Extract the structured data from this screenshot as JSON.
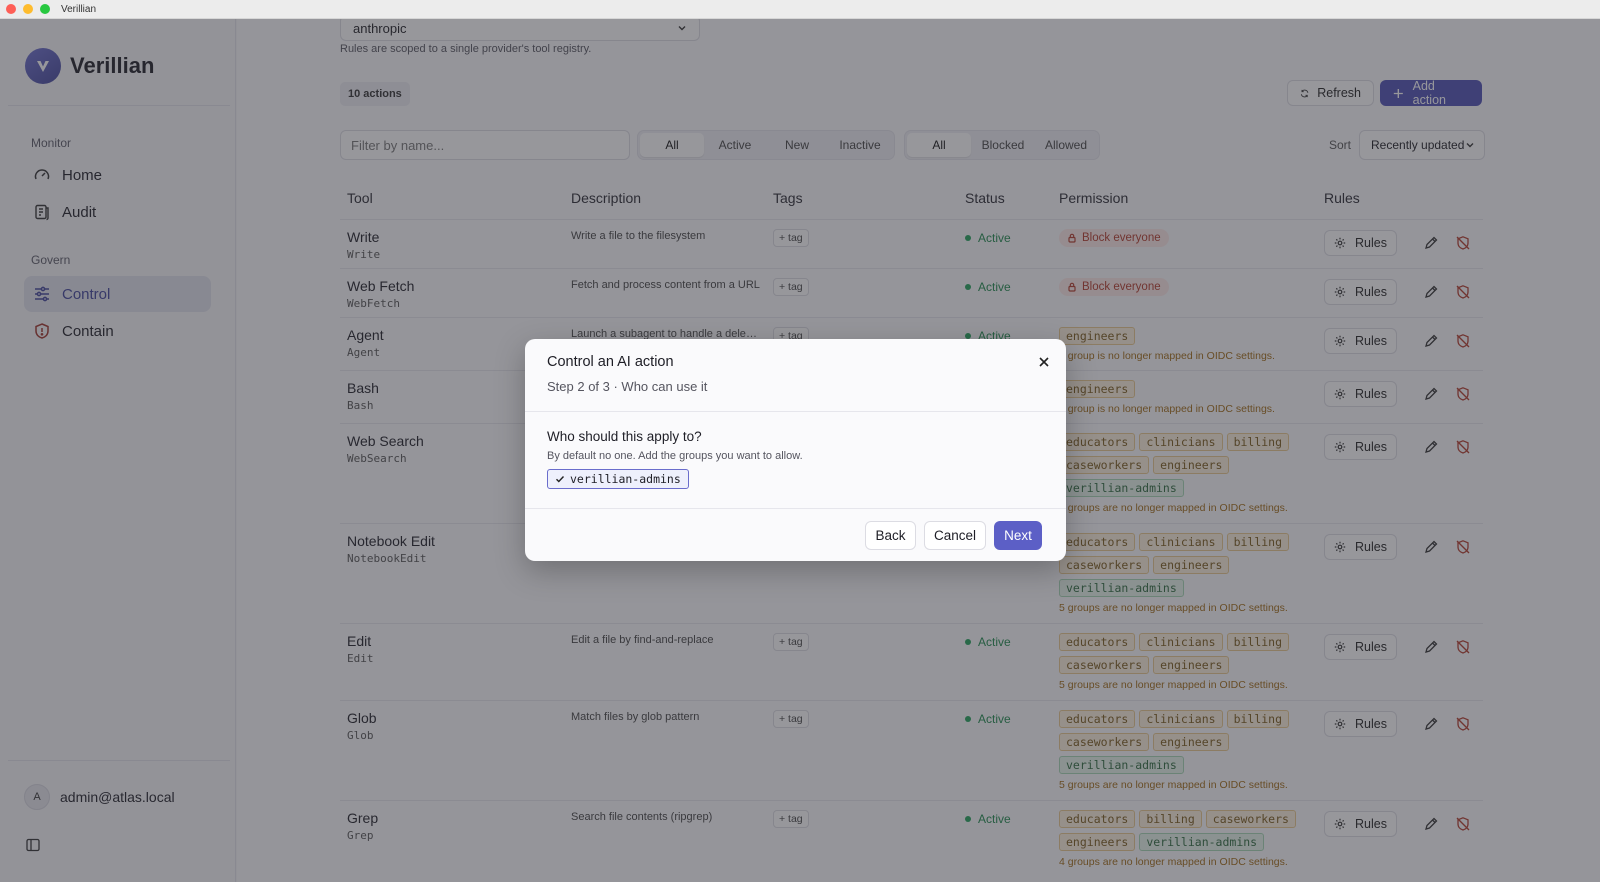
{
  "window": {
    "title": "Verillian"
  },
  "sidebar": {
    "brand": "Verillian",
    "sections": [
      {
        "title": "Monitor",
        "items": [
          {
            "label": "Home"
          },
          {
            "label": "Audit"
          }
        ]
      },
      {
        "title": "Govern",
        "items": [
          {
            "label": "Control",
            "active": true
          },
          {
            "label": "Contain"
          }
        ]
      }
    ],
    "user": {
      "initial": "A",
      "email": "admin@atlas.local"
    }
  },
  "main": {
    "provider_value": "anthropic",
    "provider_note": "Rules are scoped to a single provider's tool registry.",
    "actions_count": "10 actions",
    "refresh_label": "Refresh",
    "add_action_label": "Add action",
    "filter_placeholder": "Filter by name...",
    "status_filter": [
      "All",
      "Active",
      "New",
      "Inactive"
    ],
    "permission_filter": [
      "All",
      "Blocked",
      "Allowed"
    ],
    "sort_label": "Sort",
    "sort_value": "Recently updated",
    "columns": [
      "Tool",
      "Description",
      "Tags",
      "Status",
      "Permission",
      "Rules"
    ],
    "tag_label": "+ tag",
    "rules_label": "Rules",
    "rows": [
      {
        "name": "Write",
        "code": "Write",
        "description": "Write a file to the filesystem",
        "status": "Active",
        "perm_text": "Block everyone"
      },
      {
        "name": "Web Fetch",
        "code": "WebFetch",
        "description": "Fetch and process content from a URL",
        "status": "Active",
        "perm_text": "Block everyone"
      },
      {
        "name": "Agent",
        "code": "Agent",
        "description": "Launch a subagent to handle a delegated task",
        "status": "Active",
        "groups": [
          {
            "n": "engineers",
            "s": "warn"
          }
        ],
        "note": "1 group is no longer mapped in OIDC settings."
      },
      {
        "name": "Bash",
        "code": "Bash",
        "groups": [
          {
            "n": "engineers",
            "s": "warn"
          }
        ],
        "note": "1 group is no longer mapped in OIDC settings."
      },
      {
        "name": "Web Search",
        "code": "WebSearch",
        "groups": [
          {
            "n": "educators",
            "s": "warn"
          },
          {
            "n": "clinicians",
            "s": "warn"
          },
          {
            "n": "billing",
            "s": "warn"
          },
          {
            "n": "caseworkers",
            "s": "warn"
          },
          {
            "n": "engineers",
            "s": "warn"
          },
          {
            "n": "verillian-admins",
            "s": "ok"
          }
        ],
        "note": "5 groups are no longer mapped in OIDC settings."
      },
      {
        "name": "Notebook Edit",
        "code": "NotebookEdit",
        "groups": [
          {
            "n": "educators",
            "s": "warn"
          },
          {
            "n": "clinicians",
            "s": "warn"
          },
          {
            "n": "billing",
            "s": "warn"
          },
          {
            "n": "caseworkers",
            "s": "warn"
          },
          {
            "n": "engineers",
            "s": "warn"
          },
          {
            "n": "verillian-admins",
            "s": "ok"
          }
        ],
        "note": "5 groups are no longer mapped in OIDC settings."
      },
      {
        "name": "Edit",
        "code": "Edit",
        "description": "Edit a file by find-and-replace",
        "status": "Active",
        "groups": [
          {
            "n": "educators",
            "s": "warn"
          },
          {
            "n": "clinicians",
            "s": "warn"
          },
          {
            "n": "billing",
            "s": "warn"
          },
          {
            "n": "caseworkers",
            "s": "warn"
          },
          {
            "n": "engineers",
            "s": "warn"
          }
        ],
        "note": "5 groups are no longer mapped in OIDC settings."
      },
      {
        "name": "Glob",
        "code": "Glob",
        "description": "Match files by glob pattern",
        "status": "Active",
        "groups": [
          {
            "n": "educators",
            "s": "warn"
          },
          {
            "n": "clinicians",
            "s": "warn"
          },
          {
            "n": "billing",
            "s": "warn"
          },
          {
            "n": "caseworkers",
            "s": "warn"
          },
          {
            "n": "engineers",
            "s": "warn"
          },
          {
            "n": "verillian-admins",
            "s": "ok"
          }
        ],
        "note": "5 groups are no longer mapped in OIDC settings."
      },
      {
        "name": "Grep",
        "code": "Grep",
        "description": "Search file contents (ripgrep)",
        "status": "Active",
        "groups": [
          {
            "n": "educators",
            "s": "warn"
          },
          {
            "n": "billing",
            "s": "warn"
          },
          {
            "n": "caseworkers",
            "s": "warn"
          },
          {
            "n": "engineers",
            "s": "warn"
          },
          {
            "n": "verillian-admins",
            "s": "ok"
          }
        ],
        "note": "4 groups are no longer mapped in OIDC settings."
      }
    ]
  },
  "modal": {
    "title": "Control an AI action",
    "step": "Step 2 of 3 · Who can use it",
    "question": "Who should this apply to?",
    "hint": "By default no one. Add the groups you want to allow.",
    "selected_group": "verillian-admins",
    "back_label": "Back",
    "cancel_label": "Cancel",
    "next_label": "Next"
  },
  "colors": {
    "accent": "#4e51b4",
    "active": "#22a35a",
    "block": "#b33a2a",
    "warning": "#a16b15"
  },
  "icons": [
    "home-gauge-icon",
    "audit-icon",
    "sliders-icon",
    "shield-icon",
    "refresh-icon",
    "plus-icon",
    "gear-icon",
    "pencil-icon",
    "shield-off-icon",
    "lock-icon",
    "check-icon",
    "close-icon",
    "sidebar-toggle-icon",
    "chevron-down-icon"
  ]
}
